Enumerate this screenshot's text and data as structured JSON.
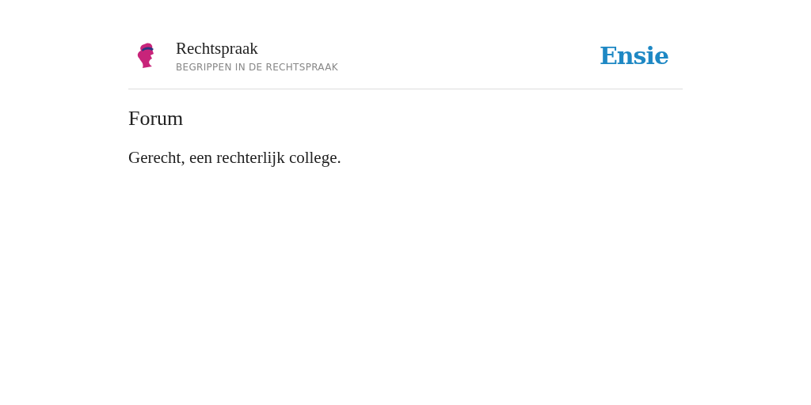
{
  "header": {
    "site_name": "Rechtspraak",
    "subtitle": "BEGRIPPEN IN DE RECHTSPRAAK",
    "brand": "Ensie"
  },
  "article": {
    "title": "Forum",
    "definition": "Gerecht, een rechterlijk college."
  }
}
